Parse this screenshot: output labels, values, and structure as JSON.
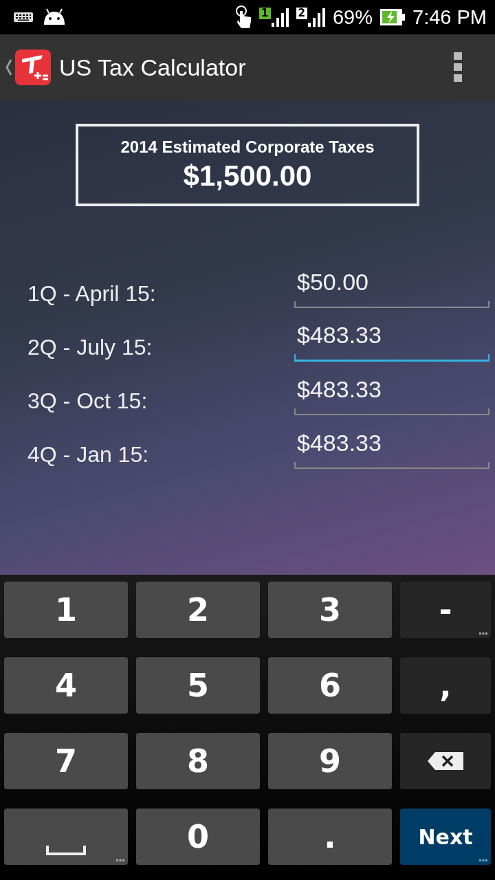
{
  "status_bar": {
    "battery": "69%",
    "time": "7:46 PM",
    "sims": [
      {
        "label": "1",
        "highlighted": true
      },
      {
        "label": "2",
        "highlighted": false
      }
    ]
  },
  "app_bar": {
    "title": "US Tax Calculator"
  },
  "summary": {
    "title": "2014 Estimated Corporate Taxes",
    "amount": "$1,500.00"
  },
  "payments": [
    {
      "label": "1Q - April 15:",
      "value": "$50.00",
      "focused": false
    },
    {
      "label": "2Q - July 15:",
      "value": "$483.33",
      "focused": true
    },
    {
      "label": "3Q - Oct 15:",
      "value": "$483.33",
      "focused": false
    },
    {
      "label": "4Q - Jan 15:",
      "value": "$483.33",
      "focused": false
    }
  ],
  "keyboard": [
    {
      "kind": "char",
      "label": "1",
      "more": false
    },
    {
      "kind": "char",
      "label": "2",
      "more": false
    },
    {
      "kind": "char",
      "label": "3",
      "more": false
    },
    {
      "kind": "symbol",
      "label": "-",
      "more": true
    },
    {
      "kind": "char",
      "label": "4",
      "more": false
    },
    {
      "kind": "char",
      "label": "5",
      "more": false
    },
    {
      "kind": "char",
      "label": "6",
      "more": false
    },
    {
      "kind": "symbol",
      "label": ",",
      "more": false
    },
    {
      "kind": "char",
      "label": "7",
      "more": false
    },
    {
      "kind": "char",
      "label": "8",
      "more": false
    },
    {
      "kind": "char",
      "label": "9",
      "more": false
    },
    {
      "kind": "backspace",
      "more": false
    },
    {
      "kind": "space",
      "more": true
    },
    {
      "kind": "char",
      "label": "0",
      "more": false
    },
    {
      "kind": "char",
      "label": ".",
      "more": false
    },
    {
      "kind": "action",
      "label": "Next",
      "more": true
    }
  ]
}
